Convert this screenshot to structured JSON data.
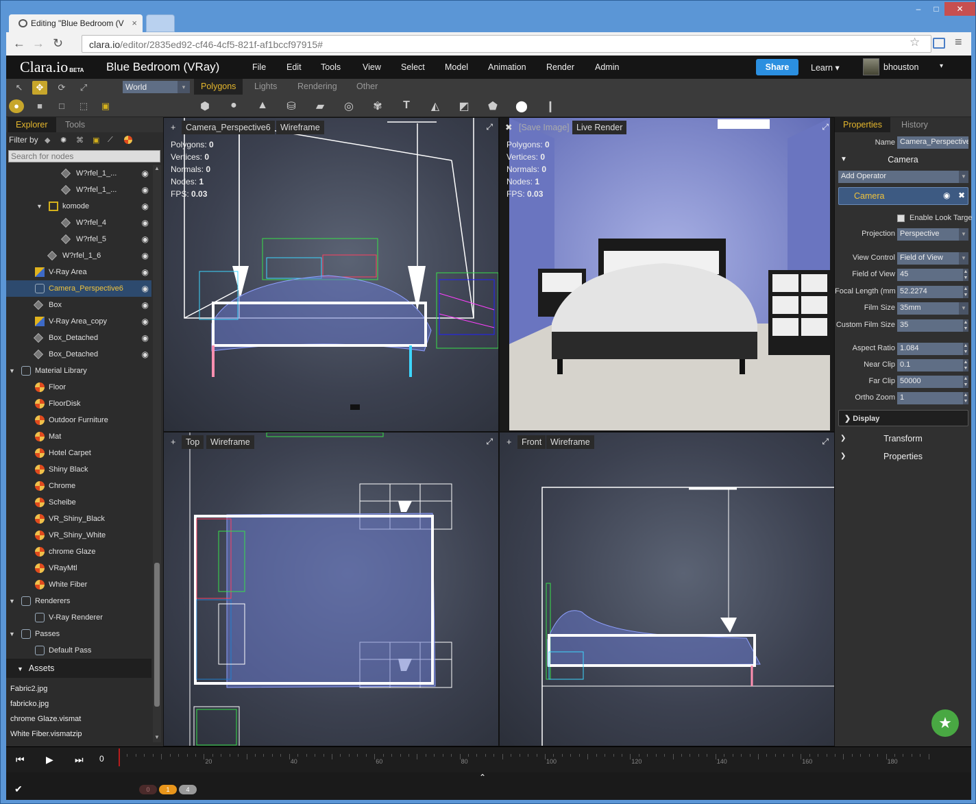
{
  "browser": {
    "tab_title": "Editing \"Blue Bedroom (V",
    "tab_close": "×",
    "url_host": "clara.io",
    "url_path": "/editor/2835ed92-cf46-4cf5-821f-af1bccf97915#",
    "min": "–",
    "max": "□",
    "close": "✕"
  },
  "app": {
    "logo": "Clara.io",
    "beta": "BETA",
    "project_title": "Blue Bedroom (VRay)",
    "menu": [
      "File",
      "Edit",
      "Tools",
      "View",
      "Select",
      "Model",
      "Animation",
      "Render",
      "Admin"
    ],
    "share": "Share",
    "learn": "Learn ▾",
    "user": "bhouston",
    "user_dd": "▾"
  },
  "toolbar": {
    "space": "World",
    "space_dd": "▾",
    "tabs": [
      "Polygons",
      "Lights",
      "Rendering",
      "Other"
    ]
  },
  "left": {
    "tab_explorer": "Explorer",
    "tab_tools": "Tools",
    "filter_label": "Filter by",
    "search_placeholder": "Search for nodes",
    "nodes": [
      {
        "label": "W?rfel_1_...",
        "icon": "geo",
        "indent": 84,
        "eye": true
      },
      {
        "label": "W?rfel_1_...",
        "icon": "geo",
        "indent": 84,
        "eye": true
      },
      {
        "label": "komode",
        "icon": "grp",
        "indent": 64,
        "eye": true,
        "arrow": "▼"
      },
      {
        "label": "W?rfel_4",
        "icon": "geo",
        "indent": 84,
        "eye": true
      },
      {
        "label": "W?rfel_5",
        "icon": "geo",
        "indent": 84,
        "eye": true
      },
      {
        "label": "W?rfel_1_6",
        "icon": "geo",
        "indent": 64,
        "eye": true
      },
      {
        "label": "V-Ray Area",
        "icon": "vra",
        "indent": 44,
        "eye": true
      },
      {
        "label": "Camera_Perspective6",
        "icon": "cam",
        "indent": 44,
        "eye": true,
        "selected": true
      },
      {
        "label": "Box",
        "icon": "geo",
        "indent": 44,
        "eye": true
      },
      {
        "label": "V-Ray Area_copy",
        "icon": "vra",
        "indent": 44,
        "eye": true
      },
      {
        "label": "Box_Detached",
        "icon": "geo",
        "indent": 44,
        "eye": true
      },
      {
        "label": "Box_Detached",
        "icon": "geo",
        "indent": 44,
        "eye": true
      },
      {
        "label": "Material Library",
        "icon": "lib",
        "indent": 24,
        "arrow": "▼"
      },
      {
        "label": "Floor",
        "icon": "mat",
        "indent": 44
      },
      {
        "label": "FloorDisk",
        "icon": "mat",
        "indent": 44
      },
      {
        "label": "Outdoor Furniture",
        "icon": "mat",
        "indent": 44
      },
      {
        "label": "Mat",
        "icon": "mat",
        "indent": 44
      },
      {
        "label": "Hotel Carpet",
        "icon": "mat",
        "indent": 44
      },
      {
        "label": "Shiny Black",
        "icon": "mat",
        "indent": 44
      },
      {
        "label": "Chrome",
        "icon": "mat",
        "indent": 44
      },
      {
        "label": "Scheibe",
        "icon": "mat",
        "indent": 44
      },
      {
        "label": "VR_Shiny_Black",
        "icon": "mat",
        "indent": 44
      },
      {
        "label": "VR_Shiny_White",
        "icon": "mat",
        "indent": 44
      },
      {
        "label": "chrome Glaze",
        "icon": "mat",
        "indent": 44
      },
      {
        "label": "VRayMtl",
        "icon": "mat",
        "indent": 44
      },
      {
        "label": "White Fiber",
        "icon": "mat",
        "indent": 44
      },
      {
        "label": "Renderers",
        "icon": "cam",
        "indent": 24,
        "arrow": "▼"
      },
      {
        "label": "V-Ray Renderer",
        "icon": "vray",
        "indent": 44
      },
      {
        "label": "Passes",
        "icon": "cam",
        "indent": 24,
        "arrow": "▼"
      },
      {
        "label": "Default Pass",
        "icon": "pass",
        "indent": 44
      }
    ],
    "assets_header": "Assets",
    "assets": [
      "Fabric2.jpg",
      "fabricko.jpg",
      "chrome Glaze.vismat",
      "White Fiber.vismatzip"
    ]
  },
  "viewports": {
    "persp": {
      "plus": "+",
      "camera": "Camera_Perspective6",
      "mode": "Wireframe"
    },
    "live": {
      "close": "✖",
      "save": "[Save Image]",
      "mode": "Live Render"
    },
    "top": {
      "plus": "+",
      "camera": "Top",
      "mode": "Wireframe"
    },
    "front": {
      "plus": "+",
      "camera": "Front",
      "mode": "Wireframe"
    },
    "stats_labels": [
      "Polygons:",
      "Vertices:",
      "Normals:",
      "Nodes:",
      "FPS:"
    ],
    "stats_values": [
      "0",
      "0",
      "0",
      "1",
      "0.03"
    ]
  },
  "properties": {
    "tab_properties": "Properties",
    "tab_history": "History",
    "name_label": "Name",
    "name_value": "Camera_Perspective",
    "camera_section": "Camera",
    "add_operator": "Add Operator",
    "operator": "Camera",
    "look_target": "Enable Look Targe",
    "projection_label": "Projection",
    "projection_value": "Perspective",
    "view_control_label": "View Control",
    "view_control_value": "Field of View",
    "fov_label": "Field of View",
    "fov_value": "45",
    "focal_label": "Focal Length (mm",
    "focal_value": "52.2274",
    "film_label": "Film Size",
    "film_value": "35mm",
    "custom_film_label": "Custom Film Size",
    "custom_film_value": "35",
    "aspect_label": "Aspect Ratio",
    "aspect_value": "1.084",
    "near_label": "Near Clip",
    "near_value": "0.1",
    "far_label": "Far Clip",
    "far_value": "50000",
    "ortho_label": "Ortho Zoom",
    "ortho_value": "1",
    "display": "Display",
    "transform": "Transform",
    "properties": "Properties"
  },
  "timeline": {
    "frame": "0",
    "ticks": [
      "20",
      "40",
      "60",
      "80",
      "100",
      "120",
      "140",
      "160",
      "180"
    ]
  },
  "status": {
    "check": "✔",
    "pill_grey": "0",
    "pill_orange": "1",
    "pill_light": "4",
    "up": "⌃"
  }
}
